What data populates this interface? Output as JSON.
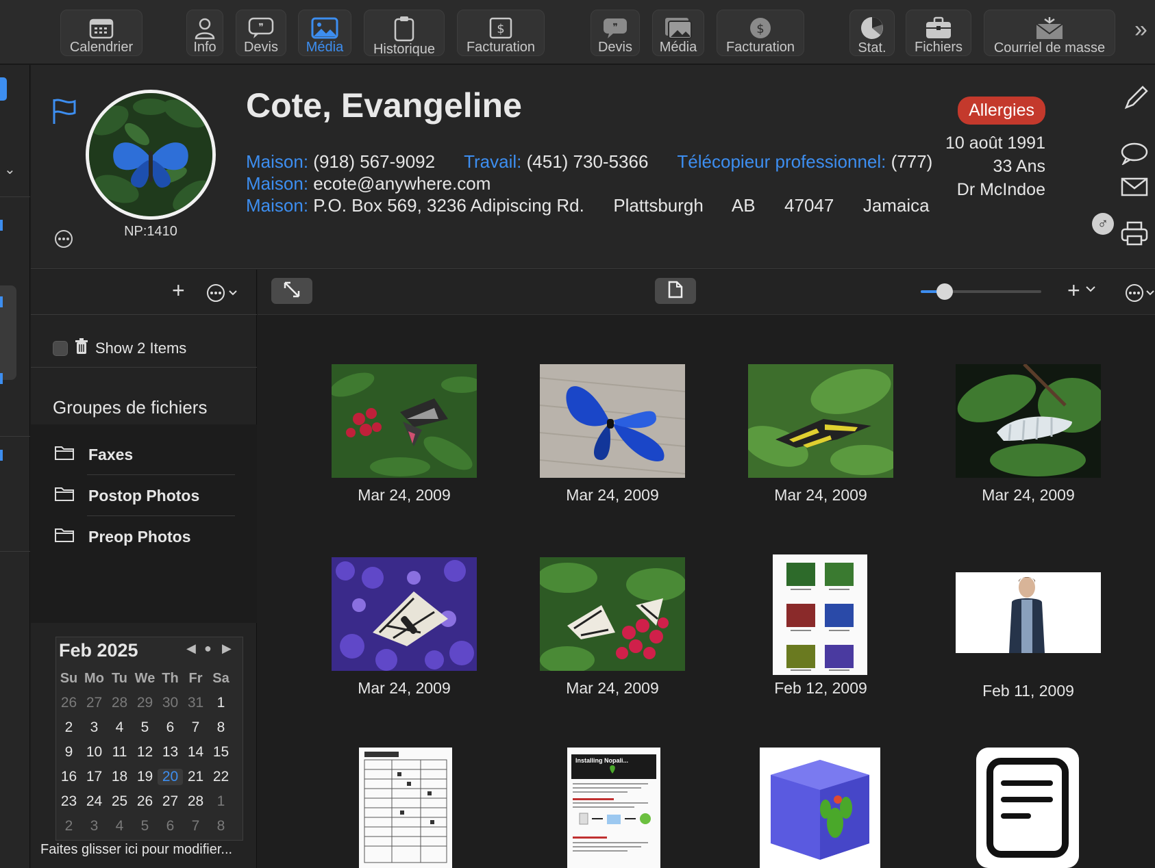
{
  "toolbar": {
    "items": [
      {
        "label": "Calendrier",
        "icon": "calendar-icon"
      },
      {
        "label": "Info",
        "icon": "person-icon"
      },
      {
        "label": "Devis",
        "icon": "quote-bubble-icon"
      },
      {
        "label": "Média",
        "icon": "photo-icon",
        "active": true
      },
      {
        "label": "Historique",
        "icon": "clipboard-icon"
      },
      {
        "label": "Facturation",
        "icon": "dollar-doc-icon"
      },
      {
        "label": "Devis",
        "icon": "quote-bubble-icon"
      },
      {
        "label": "Média",
        "icon": "photos-icon"
      },
      {
        "label": "Facturation",
        "icon": "dollar-circle-icon"
      },
      {
        "label": "Stat.",
        "icon": "pie-chart-icon"
      },
      {
        "label": "Fichiers",
        "icon": "briefcase-icon"
      },
      {
        "label": "Courriel de masse",
        "icon": "mass-mail-icon"
      }
    ],
    "more": "»"
  },
  "patient": {
    "name": "Cote, Evangeline",
    "np": "NP:1410",
    "phone_home_label": "Maison:",
    "phone_home": "(918) 567-9092",
    "phone_work_label": "Travail:",
    "phone_work": "(451) 730-5366",
    "fax_label": "Télécopieur professionnel:",
    "fax": "(777)",
    "email_label": "Maison:",
    "email": "ecote@anywhere.com",
    "address_label": "Maison:",
    "address_street": "P.O. Box 569, 3236 Adipiscing Rd.",
    "address_city": "Plattsburgh",
    "address_region": "AB",
    "address_postal": "47047",
    "address_country": "Jamaica",
    "allergies": "Allergies",
    "dob": "10 août 1991",
    "age": "33 Ans",
    "doctor": "Dr McIndoe",
    "gender_symbol": "♂"
  },
  "sidebar": {
    "show_items": "Show 2 Items",
    "groups_title": "Groupes de fichiers",
    "groups": [
      "Faxes",
      "Postop Photos",
      "Preop Photos"
    ],
    "drag_hint": "Faites glisser ici pour modifier..."
  },
  "calendar": {
    "title": "Feb 2025",
    "weekdays": [
      "Su",
      "Mo",
      "Tu",
      "We",
      "Th",
      "Fr",
      "Sa"
    ],
    "weeks": [
      [
        {
          "d": "26",
          "o": true
        },
        {
          "d": "27",
          "o": true
        },
        {
          "d": "28",
          "o": true
        },
        {
          "d": "29",
          "o": true
        },
        {
          "d": "30",
          "o": true
        },
        {
          "d": "31",
          "o": true
        },
        {
          "d": "1"
        }
      ],
      [
        {
          "d": "2"
        },
        {
          "d": "3"
        },
        {
          "d": "4"
        },
        {
          "d": "5"
        },
        {
          "d": "6"
        },
        {
          "d": "7"
        },
        {
          "d": "8"
        }
      ],
      [
        {
          "d": "9"
        },
        {
          "d": "10"
        },
        {
          "d": "11"
        },
        {
          "d": "12"
        },
        {
          "d": "13"
        },
        {
          "d": "14"
        },
        {
          "d": "15"
        }
      ],
      [
        {
          "d": "16"
        },
        {
          "d": "17"
        },
        {
          "d": "18"
        },
        {
          "d": "19"
        },
        {
          "d": "20",
          "t": true
        },
        {
          "d": "21"
        },
        {
          "d": "22"
        }
      ],
      [
        {
          "d": "23"
        },
        {
          "d": "24"
        },
        {
          "d": "25"
        },
        {
          "d": "26"
        },
        {
          "d": "27"
        },
        {
          "d": "28"
        },
        {
          "d": "1",
          "o": true
        }
      ],
      [
        {
          "d": "2",
          "o": true
        },
        {
          "d": "3",
          "o": true
        },
        {
          "d": "4",
          "o": true
        },
        {
          "d": "5",
          "o": true
        },
        {
          "d": "6",
          "o": true
        },
        {
          "d": "7",
          "o": true
        },
        {
          "d": "8",
          "o": true
        }
      ]
    ]
  },
  "media": {
    "zoom": 0.2,
    "items": [
      {
        "date": "Mar 24, 2009",
        "kind": "butterfly-red-flowers"
      },
      {
        "date": "Mar 24, 2009",
        "kind": "blue-morpho-on-stone"
      },
      {
        "date": "Mar 24, 2009",
        "kind": "yellow-swallowtail"
      },
      {
        "date": "Mar 24, 2009",
        "kind": "white-caterpillar"
      },
      {
        "date": "Mar 24, 2009",
        "kind": "butterfly-purple-hyacinth"
      },
      {
        "date": "Mar 24, 2009",
        "kind": "butterfly-pink-flowers"
      },
      {
        "date": "Feb 12, 2009",
        "kind": "contact-sheet-document"
      },
      {
        "date": "Feb 11, 2009",
        "kind": "person-video"
      },
      {
        "date": "",
        "kind": "form-document"
      },
      {
        "date": "",
        "kind": "installing-nopali-document"
      },
      {
        "date": "",
        "kind": "nopali-cube-icon"
      },
      {
        "date": "",
        "kind": "text-document-icon"
      }
    ]
  }
}
